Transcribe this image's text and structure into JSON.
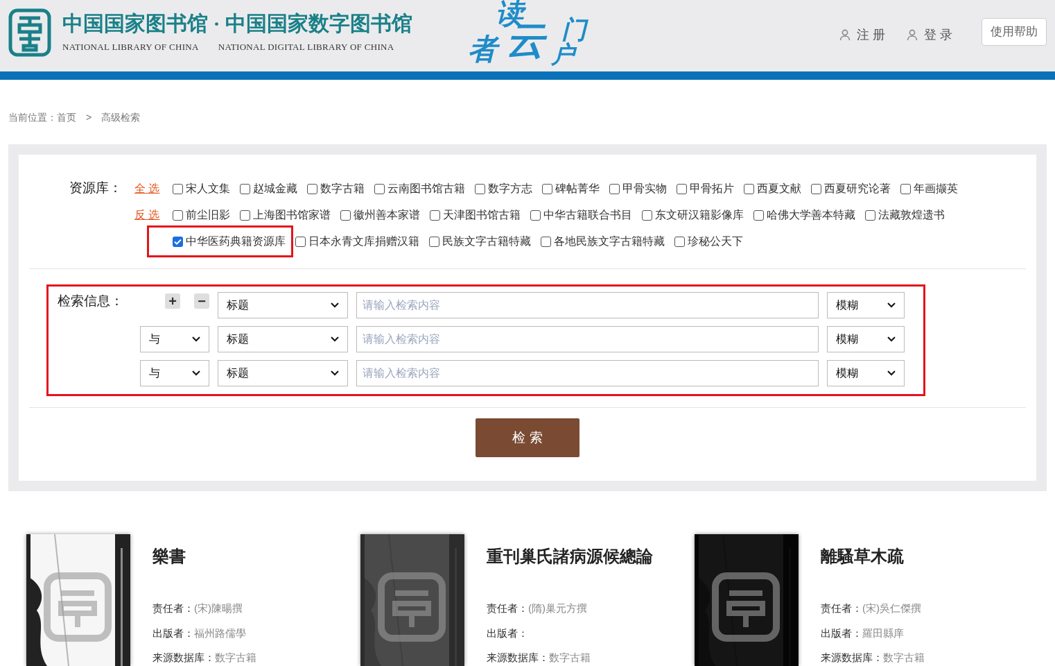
{
  "header": {
    "title_left": "中国国家图书馆",
    "title_separator": "·",
    "title_right": "中国国家数字图书馆",
    "subtitle_left": "NATIONAL LIBRARY OF CHINA",
    "subtitle_right": "NATIONAL DIGITAL LIBRARY OF CHINA",
    "art_text": "读者云门户",
    "register": "注 册",
    "login": "登 录",
    "help": "使用帮助"
  },
  "breadcrumb": {
    "label": "当前位置：",
    "home": "首页",
    "separator": ">",
    "current": "高级检索"
  },
  "resources": {
    "label": "资源库：",
    "rows": [
      {
        "action": "全 选",
        "items": [
          {
            "label": "宋人文集",
            "checked": false,
            "highlighted": false
          },
          {
            "label": "赵城金藏",
            "checked": false,
            "highlighted": false
          },
          {
            "label": "数字古籍",
            "checked": false,
            "highlighted": false
          },
          {
            "label": "云南图书馆古籍",
            "checked": false,
            "highlighted": false
          },
          {
            "label": "数字方志",
            "checked": false,
            "highlighted": false
          },
          {
            "label": "碑帖菁华",
            "checked": false,
            "highlighted": false
          },
          {
            "label": "甲骨实物",
            "checked": false,
            "highlighted": false
          },
          {
            "label": "甲骨拓片",
            "checked": false,
            "highlighted": false
          },
          {
            "label": "西夏文献",
            "checked": false,
            "highlighted": false
          },
          {
            "label": "西夏研究论著",
            "checked": false,
            "highlighted": false
          },
          {
            "label": "年画撷英",
            "checked": false,
            "highlighted": false
          }
        ]
      },
      {
        "action": "反 选",
        "items": [
          {
            "label": "前尘旧影",
            "checked": false,
            "highlighted": false
          },
          {
            "label": "上海图书馆家谱",
            "checked": false,
            "highlighted": false
          },
          {
            "label": "徽州善本家谱",
            "checked": false,
            "highlighted": false
          },
          {
            "label": "天津图书馆古籍",
            "checked": false,
            "highlighted": false
          },
          {
            "label": "中华古籍联合书目",
            "checked": false,
            "highlighted": false
          },
          {
            "label": "东文研汉籍影像库",
            "checked": false,
            "highlighted": false
          },
          {
            "label": "哈佛大学善本特藏",
            "checked": false,
            "highlighted": false
          },
          {
            "label": "法藏敦煌遗书",
            "checked": false,
            "highlighted": false
          }
        ]
      },
      {
        "items": [
          {
            "label": "中华医药典籍资源库",
            "checked": true,
            "highlighted": true
          },
          {
            "label": "日本永青文库捐赠汉籍",
            "checked": false,
            "highlighted": false
          },
          {
            "label": "民族文字古籍特藏",
            "checked": false,
            "highlighted": false
          },
          {
            "label": "各地民族文字古籍特藏",
            "checked": false,
            "highlighted": false
          },
          {
            "label": "珍秘公天下",
            "checked": false,
            "highlighted": false
          }
        ]
      }
    ]
  },
  "search": {
    "label": "检索信息：",
    "add": "+",
    "remove": "−",
    "highlighted": true,
    "rows": [
      {
        "field": "标题",
        "placeholder": "请输入检索内容",
        "match": "模糊"
      },
      {
        "operator": "与",
        "field": "标题",
        "placeholder": "请输入检索内容",
        "match": "模糊"
      },
      {
        "operator": "与",
        "field": "标题",
        "placeholder": "请输入检索内容",
        "match": "模糊"
      }
    ],
    "button": "检 索"
  },
  "results": [
    {
      "title": "樂書",
      "fields": [
        {
          "label": "责任者：",
          "value": "(宋)陳暘撰"
        },
        {
          "label": "出版者：",
          "value": "福州路儒學"
        },
        {
          "label": "来源数据库：",
          "value": "数字古籍"
        }
      ]
    },
    {
      "title": "重刊巢氏諸病源候總論",
      "fields": [
        {
          "label": "责任者：",
          "value": "(隋)巢元方撰"
        },
        {
          "label": "出版者："
        },
        {
          "label": "来源数据库：",
          "value": "数字古籍"
        }
      ]
    },
    {
      "title": "離騷草木疏",
      "fields": [
        {
          "label": "责任者：",
          "value": "(宋)吳仁傑撰"
        },
        {
          "label": "出版者：",
          "value": "羅田縣庠"
        },
        {
          "label": "来源数据库：",
          "value": "数字古籍"
        }
      ]
    }
  ]
}
